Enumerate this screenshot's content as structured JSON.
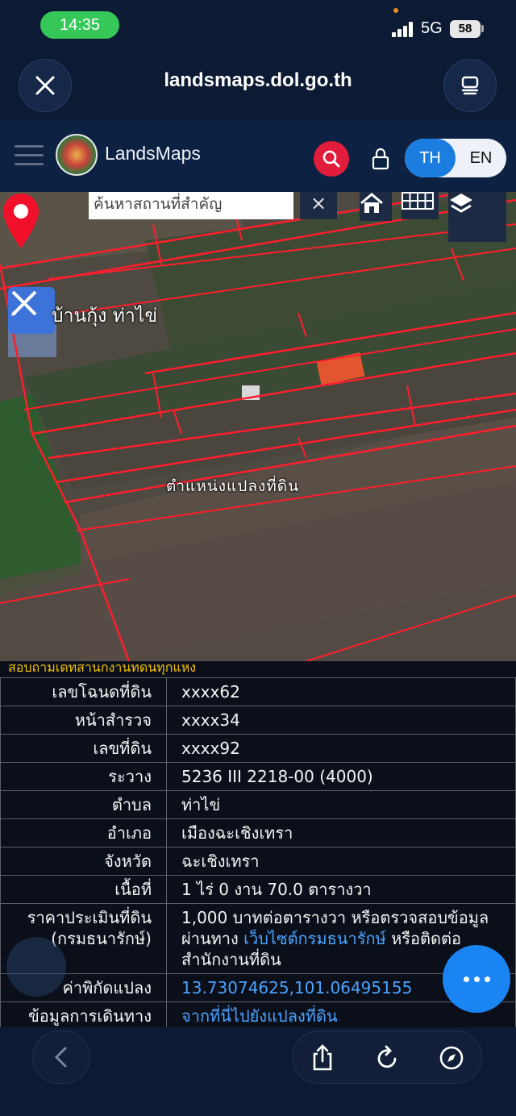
{
  "status": {
    "time": "14:35",
    "network": "5G",
    "battery": "58"
  },
  "browser": {
    "url": "landsmaps.dol.go.th"
  },
  "header": {
    "brand": "LandsMaps",
    "lang_th": "TH",
    "lang_en": "EN"
  },
  "map": {
    "search_placeholder": "ค้นหาสถานที่สำคัญ",
    "clear_label": "×",
    "place_label": "บ้านกุ้ง ท่าไข่",
    "marker_label": "ตำแหน่งแปลงที่ดิน"
  },
  "info": {
    "header_text": "สอบถามเดทสานกงานทดนทุกแหง",
    "rows": [
      {
        "key": "เลขโฉนดที่ดิน",
        "value": "xxxx62"
      },
      {
        "key": "หน้าสำรวจ",
        "value": "xxxx34"
      },
      {
        "key": "เลขที่ดิน",
        "value": "xxxx92"
      },
      {
        "key": "ระวาง",
        "value": "5236 III 2218-00 (4000)"
      },
      {
        "key": "ตำบล",
        "value": "ท่าไข่"
      },
      {
        "key": "อำเภอ",
        "value": "เมืองฉะเชิงเทรา"
      },
      {
        "key": "จังหวัด",
        "value": "ฉะเชิงเทรา"
      },
      {
        "key": "เนื้อที่",
        "value": "1 ไร่ 0 งาน 70.0 ตารางวา"
      }
    ],
    "price": {
      "key_line1": "ราคาประเมินที่ดิน",
      "key_line2": "(กรมธนารักษ์)",
      "value_line1": "1,000 บาทต่อตารางวา หรือตรวจสอบข้อมูล",
      "value_line2_prefix": "ผ่านทาง ",
      "value_link": "เว็บไซต์กรมธนารักษ์",
      "value_line2_suffix": " หรือติดต่อ",
      "value_line3": "สำนักงานที่ดิน"
    },
    "coords": {
      "key": "ค่าพิกัดแปลง",
      "value": "13.73074625,101.06495155"
    },
    "travel": {
      "key": "ข้อมูลการเดินทาง",
      "value": "จากที่นี่ไปยังแปลงที่ดิน"
    }
  },
  "colors": {
    "accent": "#1a84f2",
    "search_red": "#e21d3c",
    "parcel_line": "#ff1e2d",
    "link": "#4aa3ff"
  }
}
